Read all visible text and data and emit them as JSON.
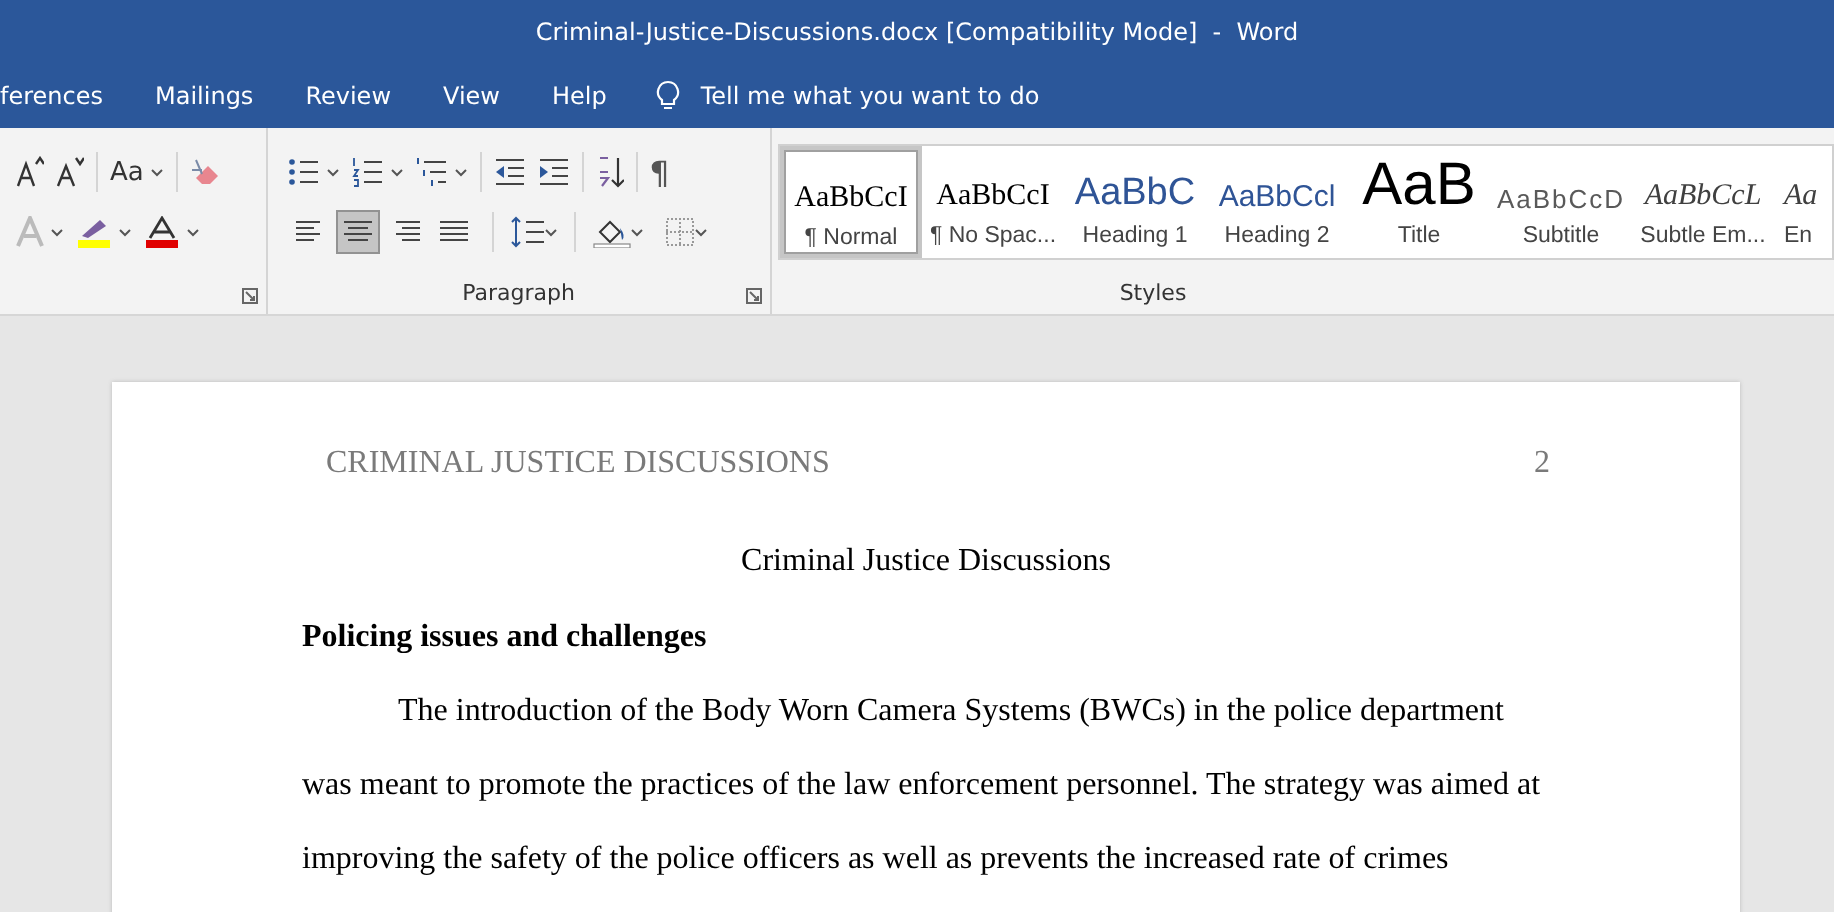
{
  "window": {
    "title": "Criminal-Justice-Discussions.docx [Compatibility Mode]  -  Word"
  },
  "ribbon_tabs": [
    {
      "label": "ferences",
      "selected": false
    },
    {
      "label": "Mailings",
      "selected": false
    },
    {
      "label": "Review",
      "selected": false
    },
    {
      "label": "View",
      "selected": false
    },
    {
      "label": "Help",
      "selected": false
    }
  ],
  "tell_me": {
    "placeholder": "Tell me what you want to do"
  },
  "font_group": {
    "change_case": "Aa"
  },
  "paragraph_group": {
    "label": "Paragraph",
    "pilcrow": "¶",
    "alignment": [
      {
        "kind": "left",
        "selected": false
      },
      {
        "kind": "center",
        "selected": true
      },
      {
        "kind": "right",
        "selected": false
      },
      {
        "kind": "justify",
        "selected": false
      }
    ]
  },
  "styles_group": {
    "label": "Styles",
    "items": [
      {
        "kind": "normal",
        "preview": "AaBbCcI",
        "name": "¶ Normal",
        "selected": true
      },
      {
        "kind": "nospacing",
        "preview": "AaBbCcI",
        "name": "¶ No Spac...",
        "selected": false
      },
      {
        "kind": "heading1",
        "preview": "AaBbC",
        "name": "Heading 1",
        "selected": false
      },
      {
        "kind": "heading2",
        "preview": "AaBbCcl",
        "name": "Heading 2",
        "selected": false
      },
      {
        "kind": "title",
        "preview": "AaB",
        "name": "Title",
        "selected": false
      },
      {
        "kind": "subtitle",
        "preview": "AaBbCcD",
        "name": "Subtitle",
        "selected": false
      },
      {
        "kind": "subtle",
        "preview": "AaBbCcL",
        "name": "Subtle Em...",
        "selected": false
      },
      {
        "kind": "emphasis",
        "preview": "Aa",
        "name": "En",
        "selected": false
      }
    ]
  },
  "document": {
    "header": "CRIMINAL JUSTICE DISCUSSIONS",
    "page_number": "2",
    "title": "Criminal Justice Discussions",
    "heading": "Policing issues and challenges",
    "paragraph": "The introduction of the Body Worn Camera Systems (BWCs) in the police department was meant to promote the practices of the law enforcement personnel. The strategy was aimed at improving the safety of the police officers as well as prevents the increased rate of crimes"
  }
}
